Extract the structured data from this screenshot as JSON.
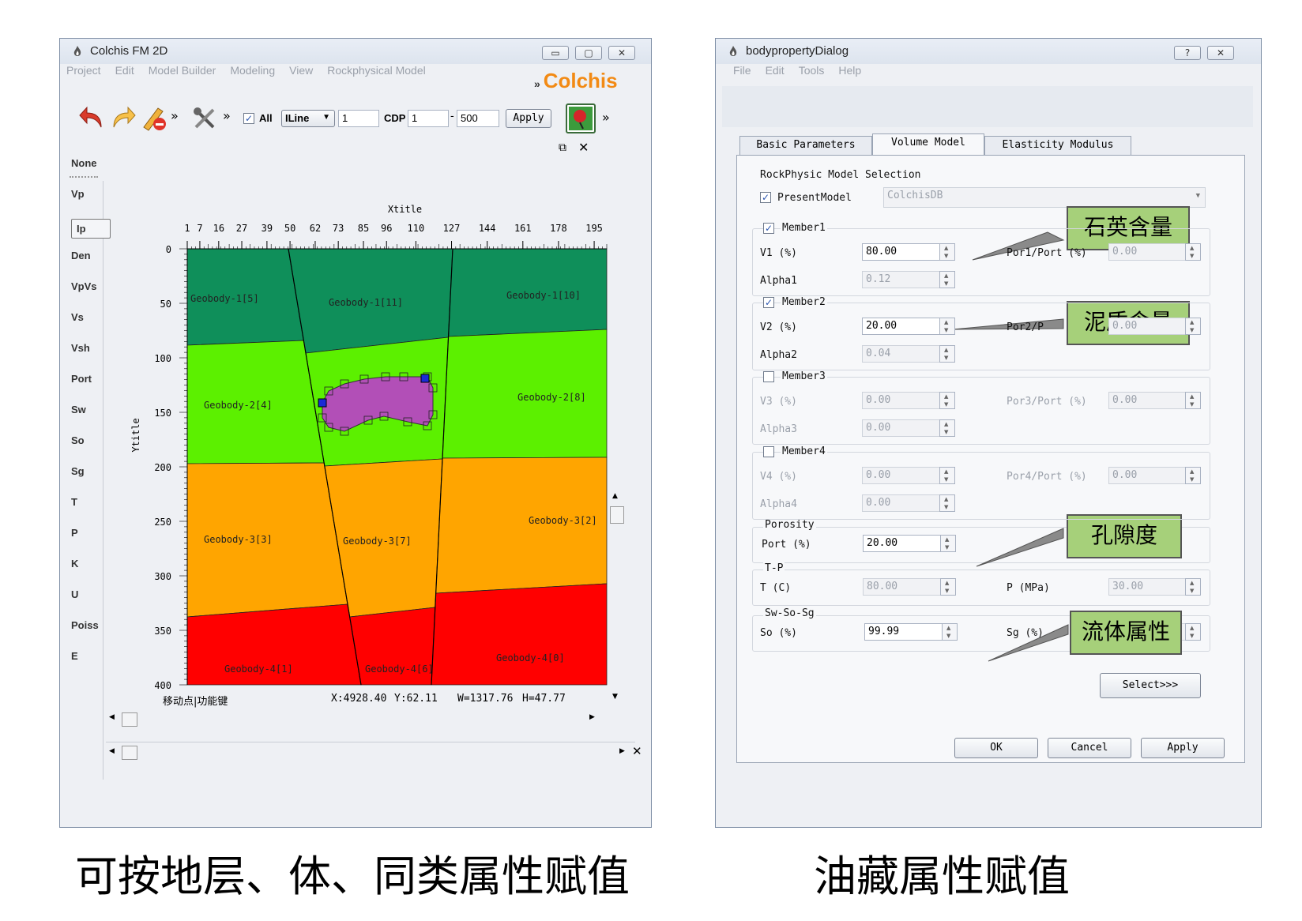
{
  "captions": {
    "left": "可按地层、体、同类属性赋值",
    "right": "油藏属性赋值"
  },
  "left_window": {
    "title": "Colchis FM 2D",
    "menu": [
      "Project",
      "Edit",
      "Model Builder",
      "Modeling",
      "View",
      "Rockphysical Model"
    ],
    "brand": "Colchis",
    "toolbar": {
      "all_label": "All",
      "line_select": "ILine",
      "line_value": "1",
      "cdp_label": "CDP",
      "cdp_from": "1",
      "cdp_to": "500",
      "apply": "Apply"
    },
    "sidebar": [
      "None",
      "Vp",
      "Ip",
      "Den",
      "VpVs",
      "Vs",
      "Vsh",
      "Port",
      "Sw",
      "So",
      "Sg",
      "T",
      "P",
      "K",
      "U",
      "Poiss",
      "E"
    ],
    "sidebar_active": "Ip",
    "plot": {
      "xtitle": "Xtitle",
      "ytitle": "Ytitle",
      "x_ticks": [
        {
          "x": 1,
          "l": "1"
        },
        {
          "x": 7,
          "l": "7"
        },
        {
          "x": 16,
          "l": "16"
        },
        {
          "x": 27,
          "l": "27"
        },
        {
          "x": 39,
          "l": "39"
        },
        {
          "x": 50,
          "l": "50"
        },
        {
          "x": 62,
          "l": "62"
        },
        {
          "x": 73,
          "l": "73"
        },
        {
          "x": 85,
          "l": "85"
        },
        {
          "x": 96,
          "l": "96"
        },
        {
          "x": 110,
          "l": "110"
        },
        {
          "x": 127,
          "l": "127"
        },
        {
          "x": 144,
          "l": "144"
        },
        {
          "x": 161,
          "l": "161"
        },
        {
          "x": 178,
          "l": "178"
        },
        {
          "x": 195,
          "l": "195"
        }
      ],
      "y_ticks": [
        0,
        50,
        100,
        150,
        200,
        250,
        300,
        350,
        400
      ],
      "layer_colors": [
        "#0f8f5a",
        "#5cf000",
        "#ffa500",
        "#ff0000"
      ],
      "body_color": "#b24fb7",
      "labels": [
        "Geobody-1[5]",
        "Geobody-1[11]",
        "Geobody-1[10]",
        "Geobody-2[4]",
        "Geobody-2[8]",
        "Geobody-3[3]",
        "Geobody-3[7]",
        "Geobody-3[2]",
        "Geobody-4[1]",
        "Geobody-4[6]",
        "Geobody-4[0]"
      ]
    },
    "status": {
      "mode": "移动点|功能键",
      "x": "X:4928.40",
      "y": "Y:62.11",
      "w": "W=1317.76",
      "h": "H=47.77"
    }
  },
  "right_window": {
    "title": "bodypropertyDialog",
    "menu": [
      "File",
      "Edit",
      "Tools",
      "Help"
    ],
    "tabs": [
      "Basic Parameters",
      "Volume Model",
      "Elasticity Modulus"
    ],
    "active_tab": "Volume Model",
    "section_title": "RockPhysic Model Selection",
    "present_model_label": "PresentModel",
    "present_model_value": "ColchisDB",
    "member1": {
      "title": "Member1",
      "v_label": "V1 (%)",
      "v": "80.00",
      "alpha_label": "Alpha1",
      "alpha": "0.12",
      "por_label": "Por1/Port (%)",
      "por": "0.00"
    },
    "member2": {
      "title": "Member2",
      "v_label": "V2 (%)",
      "v": "20.00",
      "alpha_label": "Alpha2",
      "alpha": "0.04",
      "por_label": "Por2/P",
      "por": "0.00"
    },
    "member3": {
      "title": "Member3",
      "v_label": "V3 (%)",
      "v": "0.00",
      "alpha_label": "Alpha3",
      "alpha": "0.00",
      "por_label": "Por3/Port (%)",
      "por": "0.00"
    },
    "member4": {
      "title": "Member4",
      "v_label": "V4 (%)",
      "v": "0.00",
      "alpha_label": "Alpha4",
      "alpha": "0.00",
      "por_label": "Por4/Port (%)",
      "por": "0.00"
    },
    "porosity": {
      "title": "Porosity",
      "label": "Port (%)",
      "value": "20.00"
    },
    "tp": {
      "title": "T-P",
      "t_label": "T (C)",
      "t": "80.00",
      "p_label": "P (MPa)",
      "p": "30.00"
    },
    "sw": {
      "title": "Sw-So-Sg",
      "so_label": "So (%)",
      "so": "99.99",
      "sg_label": "Sg (%)"
    },
    "select_button": "Select>>>",
    "ok": "OK",
    "cancel": "Cancel",
    "apply": "Apply",
    "callouts": [
      "石英含量",
      "泥质含量",
      "孔隙度",
      "流体属性"
    ]
  }
}
